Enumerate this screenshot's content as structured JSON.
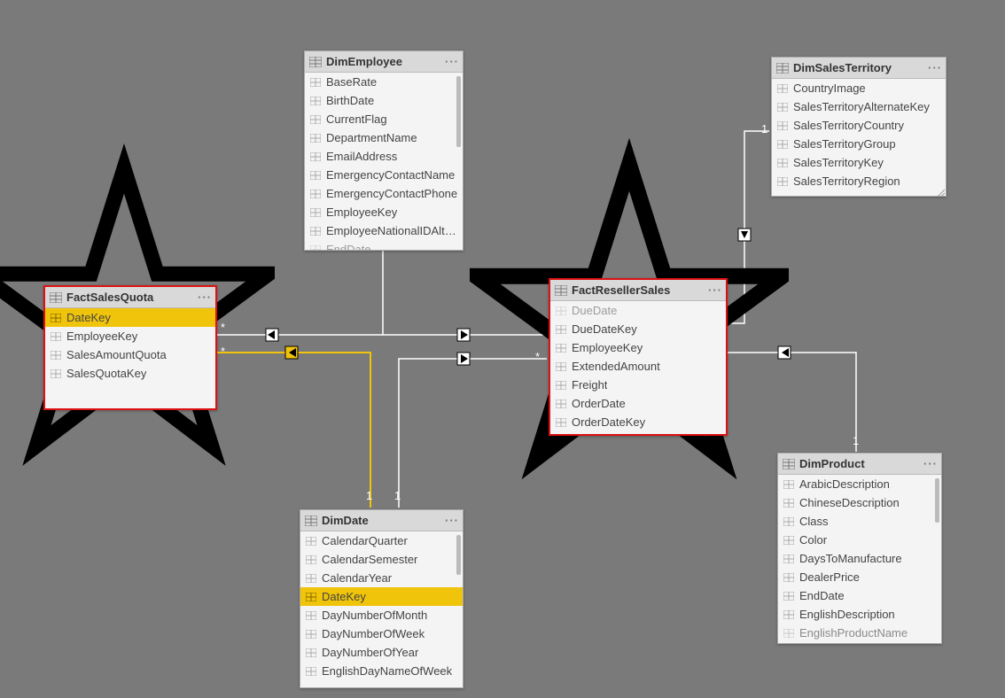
{
  "tables": {
    "dimEmployee": {
      "title": "DimEmployee",
      "fields": [
        {
          "name": "BaseRate"
        },
        {
          "name": "BirthDate"
        },
        {
          "name": "CurrentFlag"
        },
        {
          "name": "DepartmentName"
        },
        {
          "name": "EmailAddress"
        },
        {
          "name": "EmergencyContactName"
        },
        {
          "name": "EmergencyContactPhone"
        },
        {
          "name": "EmployeeKey"
        },
        {
          "name": "EmployeeNationalIDAlter..."
        },
        {
          "name": "EndDate"
        }
      ]
    },
    "dimSalesTerritory": {
      "title": "DimSalesTerritory",
      "fields": [
        {
          "name": "CountryImage"
        },
        {
          "name": "SalesTerritoryAlternateKey"
        },
        {
          "name": "SalesTerritoryCountry"
        },
        {
          "name": "SalesTerritoryGroup"
        },
        {
          "name": "SalesTerritoryKey"
        },
        {
          "name": "SalesTerritoryRegion"
        }
      ]
    },
    "factSalesQuota": {
      "title": "FactSalesQuota",
      "fields": [
        {
          "name": "DateKey",
          "selected": true
        },
        {
          "name": "EmployeeKey"
        },
        {
          "name": "SalesAmountQuota"
        },
        {
          "name": "SalesQuotaKey"
        }
      ]
    },
    "factResellerSales": {
      "title": "FactResellerSales",
      "fields": [
        {
          "name": "DueDate"
        },
        {
          "name": "DueDateKey"
        },
        {
          "name": "EmployeeKey"
        },
        {
          "name": "ExtendedAmount"
        },
        {
          "name": "Freight"
        },
        {
          "name": "OrderDate"
        },
        {
          "name": "OrderDateKey"
        }
      ]
    },
    "dimDate": {
      "title": "DimDate",
      "fields": [
        {
          "name": "CalendarQuarter"
        },
        {
          "name": "CalendarSemester"
        },
        {
          "name": "CalendarYear"
        },
        {
          "name": "DateKey",
          "selected": true
        },
        {
          "name": "DayNumberOfMonth"
        },
        {
          "name": "DayNumberOfWeek"
        },
        {
          "name": "DayNumberOfYear"
        },
        {
          "name": "EnglishDayNameOfWeek"
        }
      ]
    },
    "dimProduct": {
      "title": "DimProduct",
      "fields": [
        {
          "name": "ArabicDescription"
        },
        {
          "name": "ChineseDescription"
        },
        {
          "name": "Class"
        },
        {
          "name": "Color"
        },
        {
          "name": "DaysToManufacture"
        },
        {
          "name": "DealerPrice"
        },
        {
          "name": "EndDate"
        },
        {
          "name": "EnglishDescription"
        },
        {
          "name": "EnglishProductName"
        }
      ]
    }
  },
  "cardinality": {
    "one": "1",
    "many": "*"
  },
  "menu_label": "···"
}
